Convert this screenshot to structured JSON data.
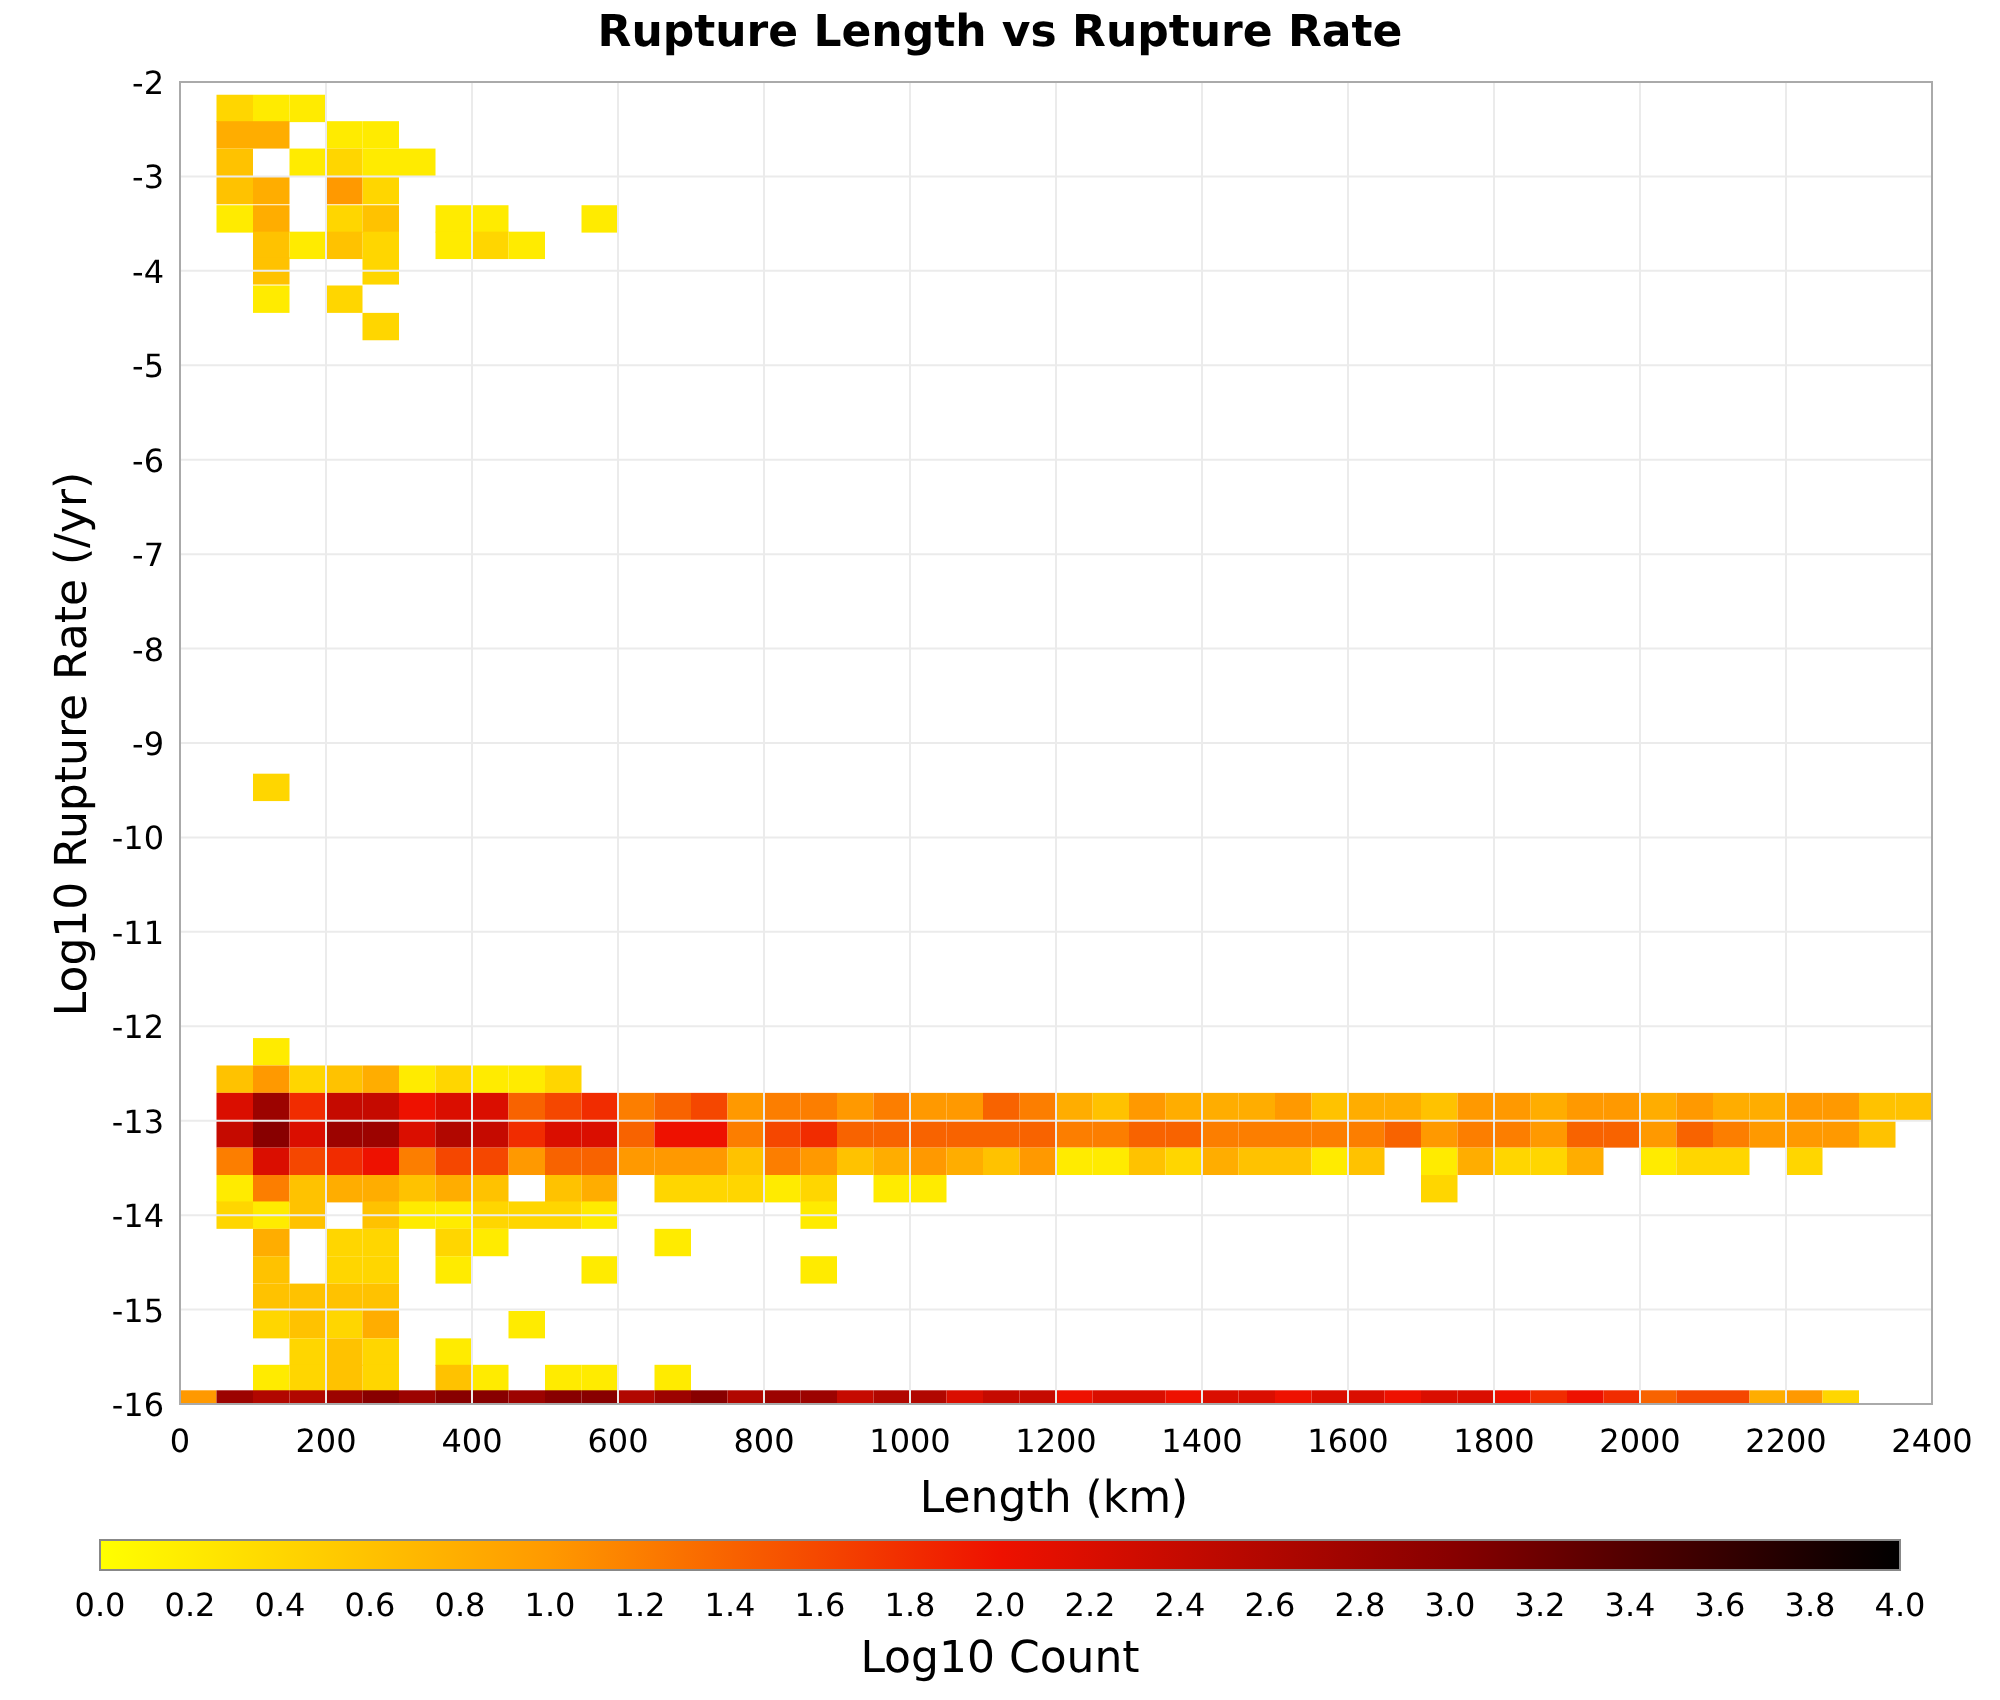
{
  "chart_data": {
    "type": "heatmap",
    "title": "Rupture Length vs Rupture Rate",
    "xlabel": "Length (km)",
    "ylabel": "Log10 Rupture Rate (/yr)",
    "xlim": [
      0,
      2400
    ],
    "ylim": [
      -16,
      -2
    ],
    "xticks": [
      0,
      200,
      400,
      600,
      800,
      1000,
      1200,
      1400,
      1600,
      1800,
      2000,
      2200,
      2400
    ],
    "yticks": [
      -2,
      -3,
      -4,
      -5,
      -6,
      -7,
      -8,
      -9,
      -10,
      -11,
      -12,
      -13,
      -14,
      -15,
      -16
    ],
    "grid": true
  },
  "colorbar": {
    "label": "Log10 Count",
    "ticks": [
      "0.0",
      "0.2",
      "0.4",
      "0.6",
      "0.8",
      "1.0",
      "1.2",
      "1.4",
      "1.6",
      "1.8",
      "2.0",
      "2.2",
      "2.4",
      "2.6",
      "2.8",
      "3.0",
      "3.2",
      "3.4",
      "3.6",
      "3.8",
      "4.0"
    ]
  }
}
